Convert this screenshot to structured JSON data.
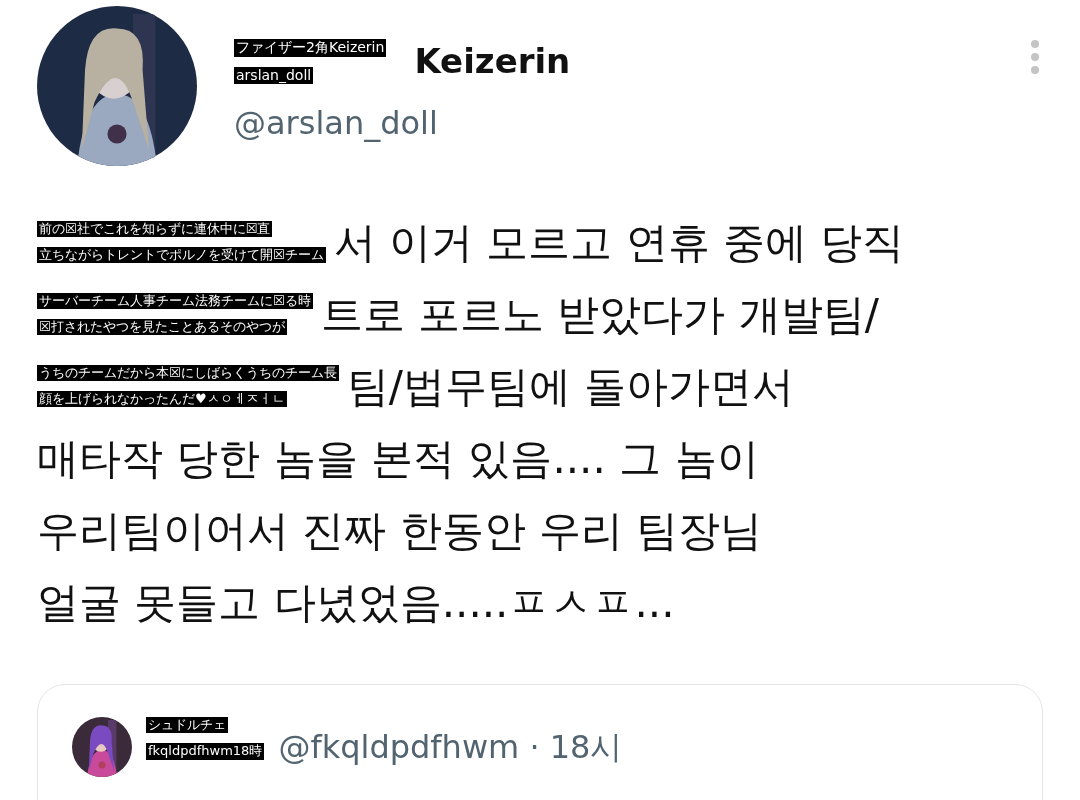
{
  "author": {
    "overlay": [
      "ファイザー2角Keizerin",
      "arslan_doll"
    ],
    "name": "Keizerin",
    "handle": "@arslan_doll"
  },
  "body_lines": [
    {
      "overlay": [
        "前の☒社でこれを知らずに連休中に☒直",
        "立ちながらトレントでポルノを受けて開☒チーム"
      ],
      "text": "서 이거 모르고 연휴 중에 당직"
    },
    {
      "overlay": [
        "サーバーチーム人事チーム法務チームに☒る時",
        "☒打されたやつを見たことあるそのやつが"
      ],
      "text": "트로 포르노 받았다가 개발팀/"
    },
    {
      "overlay": [
        "うちのチームだから本☒にしばらくうちのチーム長",
        "顔を上げられなかったんだ♥ㅅㅇㅔㅈㅓㄴ"
      ],
      "text": "팀/법무팀에 돌아가면서"
    },
    {
      "text": "매타작 당한 놈을 본적 있음.... 그 놈이"
    },
    {
      "text": "우리팀이어서 진짜 한동안 우리 팀장님"
    },
    {
      "text": "얼굴 못들고 다녔었음.....ㅍㅅㅍ..."
    }
  ],
  "quoted_tweet": {
    "overlay": [
      "シュドルチェ",
      "fkqldpdfhwm18時"
    ],
    "handle_time": "@fkqldpdfhwm · 18시"
  }
}
